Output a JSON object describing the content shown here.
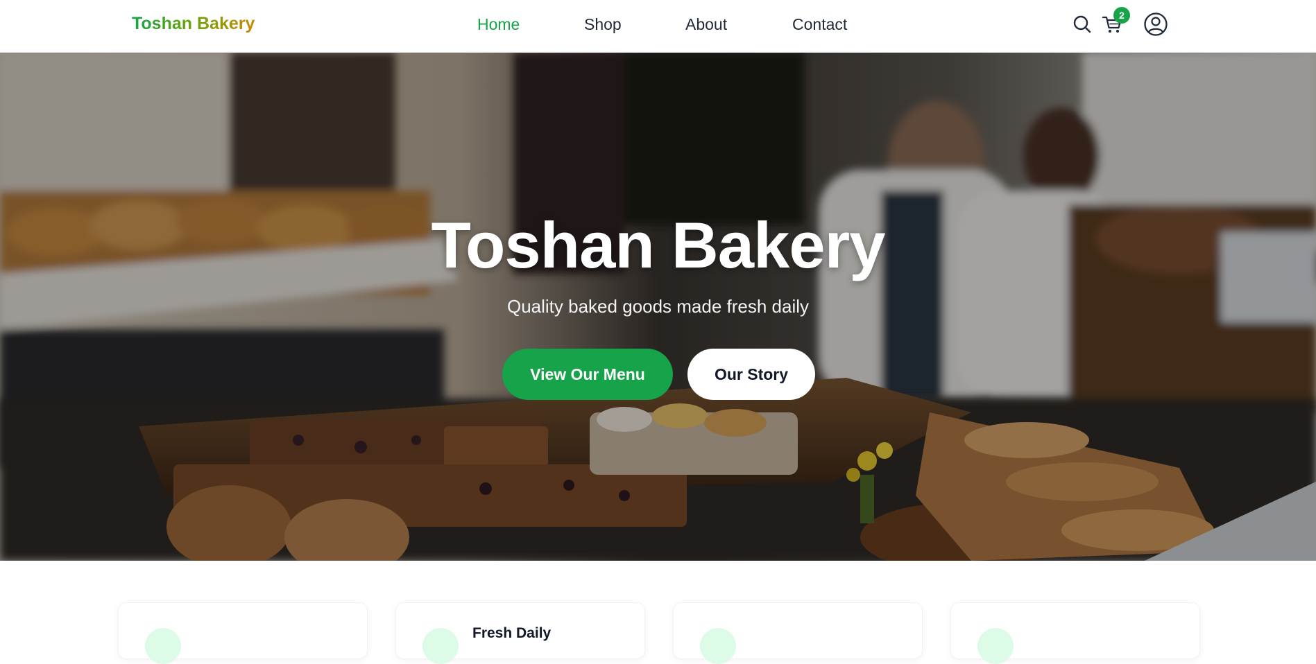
{
  "header": {
    "logo": "Toshan Bakery",
    "nav": [
      {
        "label": "Home",
        "active": true
      },
      {
        "label": "Shop",
        "active": false
      },
      {
        "label": "About",
        "active": false
      },
      {
        "label": "Contact",
        "active": false
      }
    ],
    "icons": {
      "search": "search-icon",
      "cart": "cart-icon",
      "account": "user-circle-icon"
    },
    "cart_count": "2"
  },
  "hero": {
    "title": "Toshan Bakery",
    "subtitle": "Quality baked goods made fresh daily",
    "primary_button": "View Our Menu",
    "secondary_button": "Our Story",
    "background_image": "bakery-counter-photo"
  },
  "features": [
    {
      "title": ""
    },
    {
      "title": "Fresh Daily"
    },
    {
      "title": ""
    },
    {
      "title": ""
    }
  ],
  "colors": {
    "accent": "#16a34a",
    "logo_gradient_end": "#ca8a04",
    "text": "#1f2937"
  }
}
